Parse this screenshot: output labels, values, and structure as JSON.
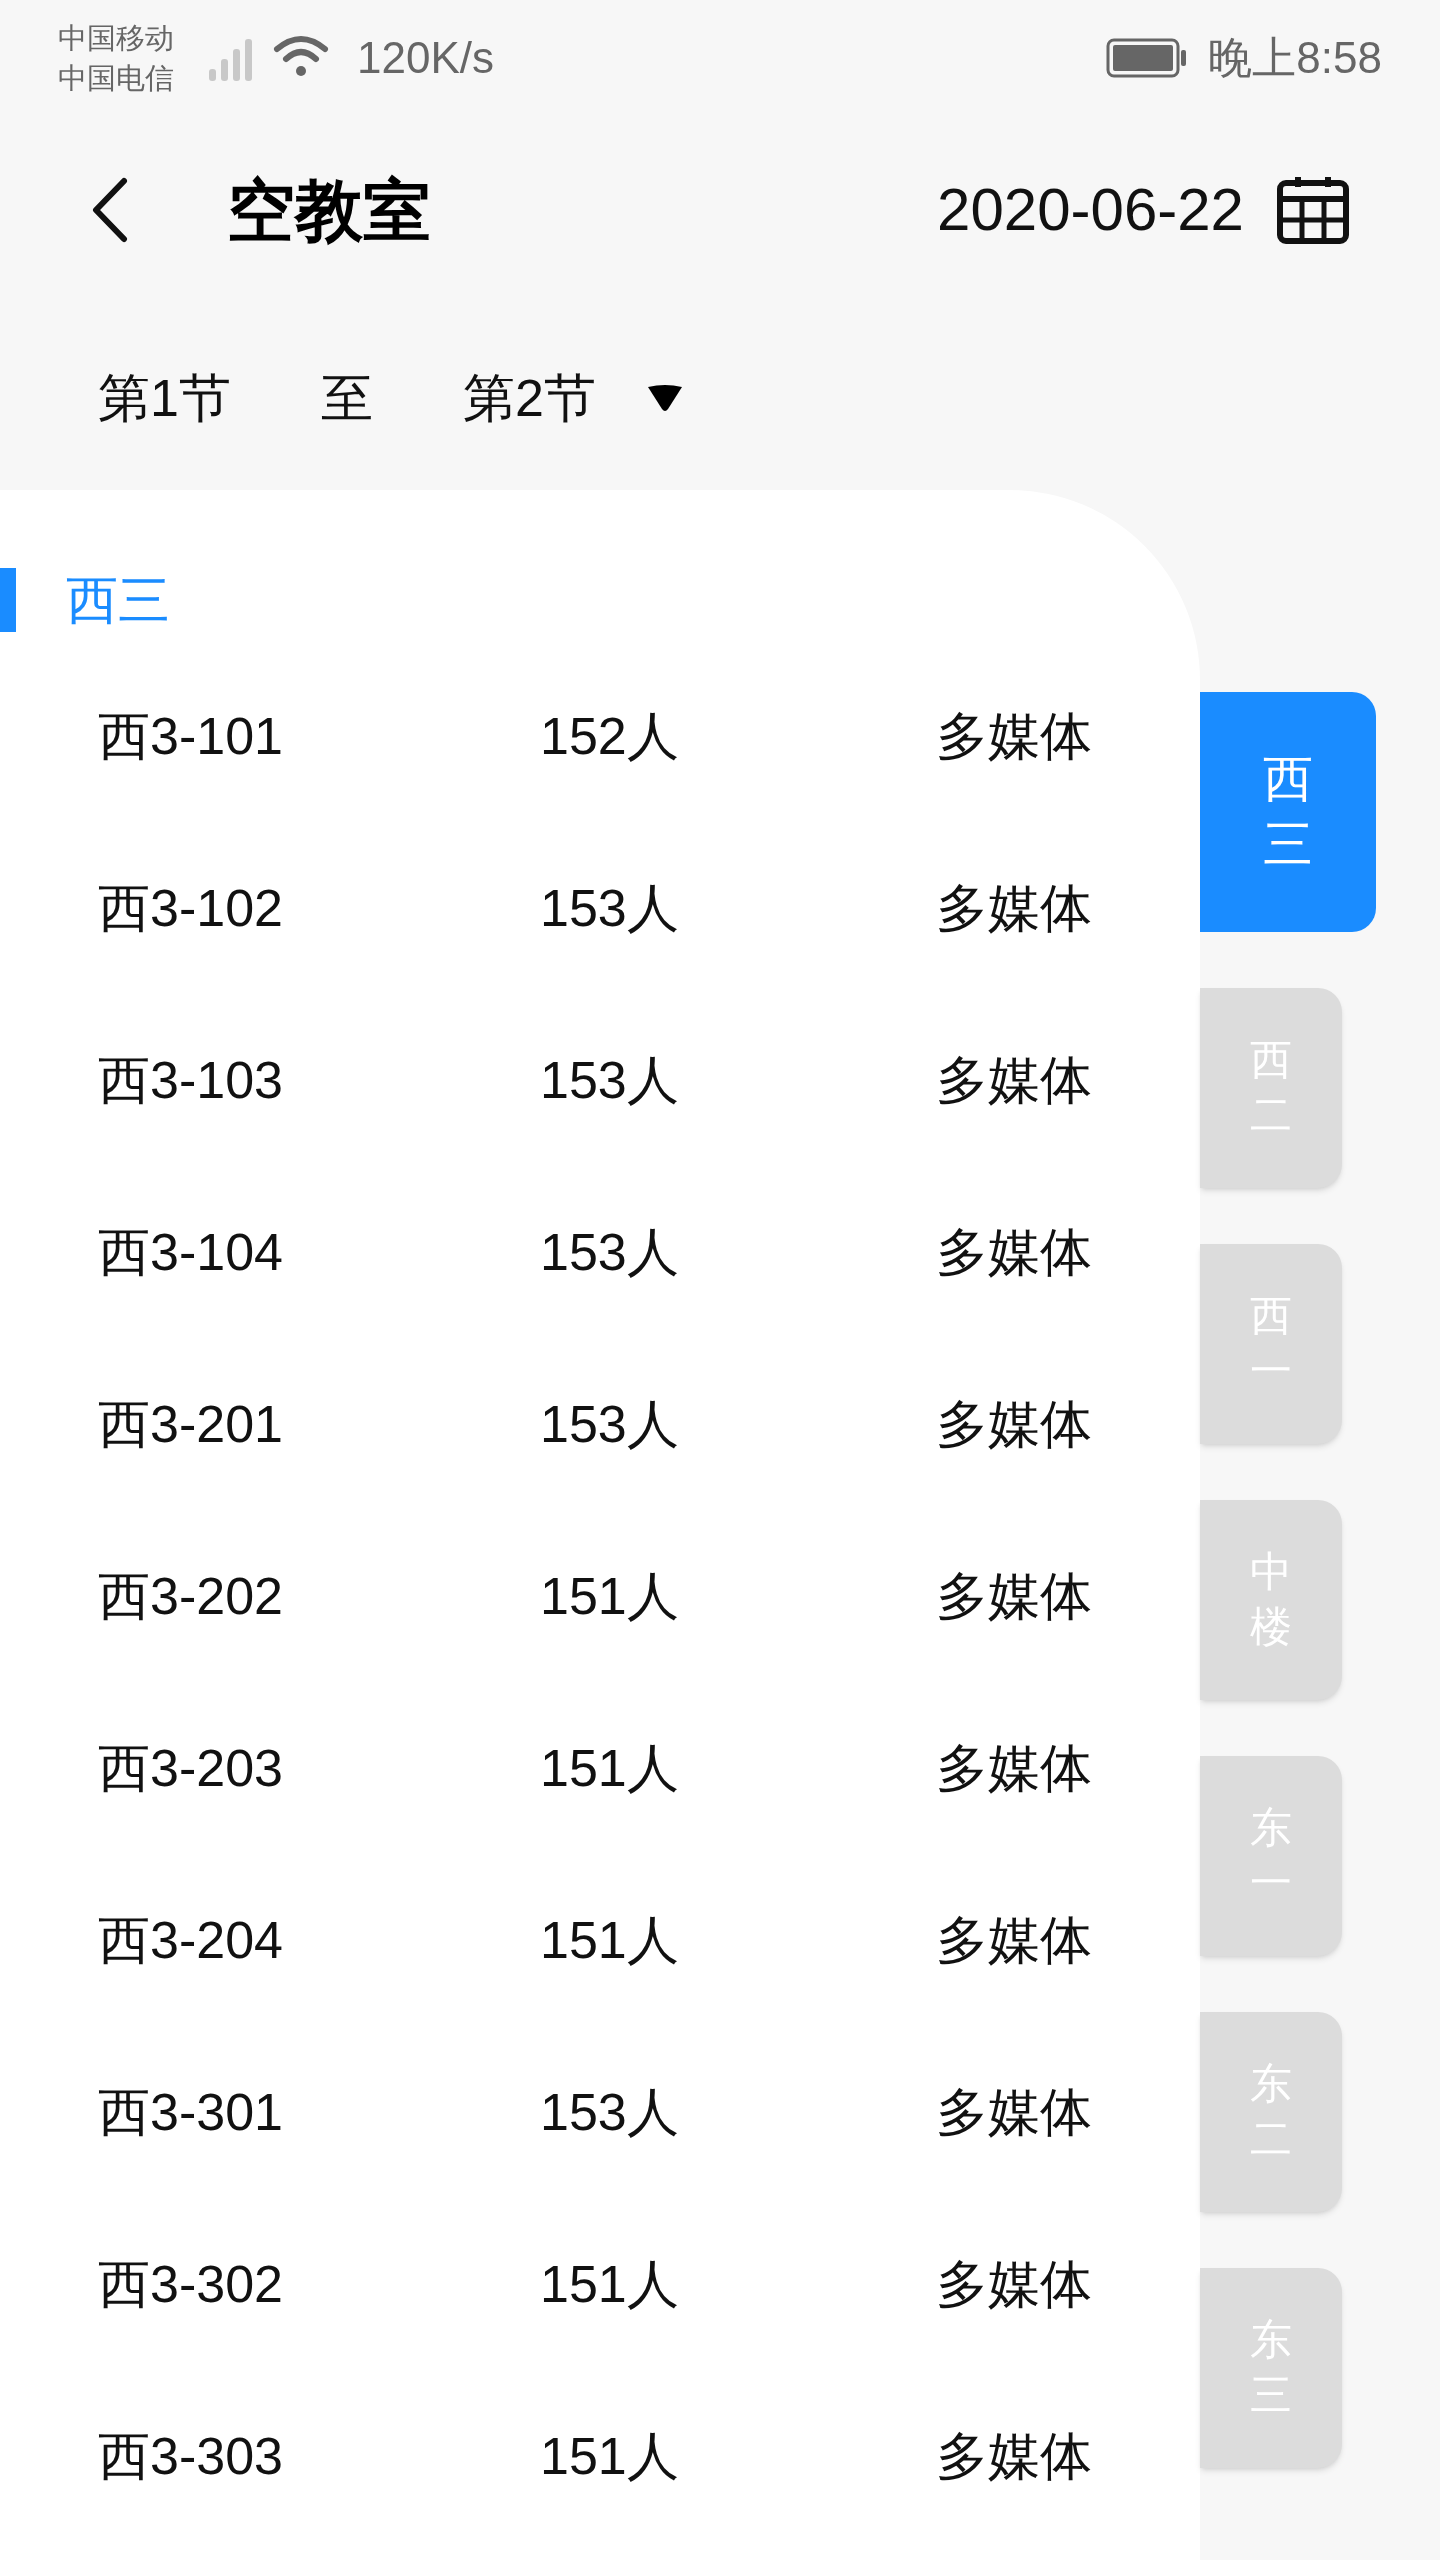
{
  "status_bar": {
    "carriers": [
      "中国移动",
      "中国电信"
    ],
    "speed": "120K/s",
    "time": "晚上8:58"
  },
  "header": {
    "title": "空教室",
    "date": "2020-06-22"
  },
  "period": {
    "start": "第1节",
    "separator": "至",
    "end": "第2节"
  },
  "section": {
    "title": "西三"
  },
  "rooms": [
    {
      "name": "西3-101",
      "capacity": "152人",
      "type": "多媒体"
    },
    {
      "name": "西3-102",
      "capacity": "153人",
      "type": "多媒体"
    },
    {
      "name": "西3-103",
      "capacity": "153人",
      "type": "多媒体"
    },
    {
      "name": "西3-104",
      "capacity": "153人",
      "type": "多媒体"
    },
    {
      "name": "西3-201",
      "capacity": "153人",
      "type": "多媒体"
    },
    {
      "name": "西3-202",
      "capacity": "151人",
      "type": "多媒体"
    },
    {
      "name": "西3-203",
      "capacity": "151人",
      "type": "多媒体"
    },
    {
      "name": "西3-204",
      "capacity": "151人",
      "type": "多媒体"
    },
    {
      "name": "西3-301",
      "capacity": "153人",
      "type": "多媒体"
    },
    {
      "name": "西3-302",
      "capacity": "151人",
      "type": "多媒体"
    },
    {
      "name": "西3-303",
      "capacity": "151人",
      "type": "多媒体"
    }
  ],
  "building_tabs": [
    {
      "label": "西三",
      "selected": true
    },
    {
      "label": "西二",
      "selected": false
    },
    {
      "label": "西一",
      "selected": false
    },
    {
      "label": "中楼",
      "selected": false
    },
    {
      "label": "东一",
      "selected": false
    },
    {
      "label": "东二",
      "selected": false
    },
    {
      "label": "东三",
      "selected": false
    }
  ]
}
